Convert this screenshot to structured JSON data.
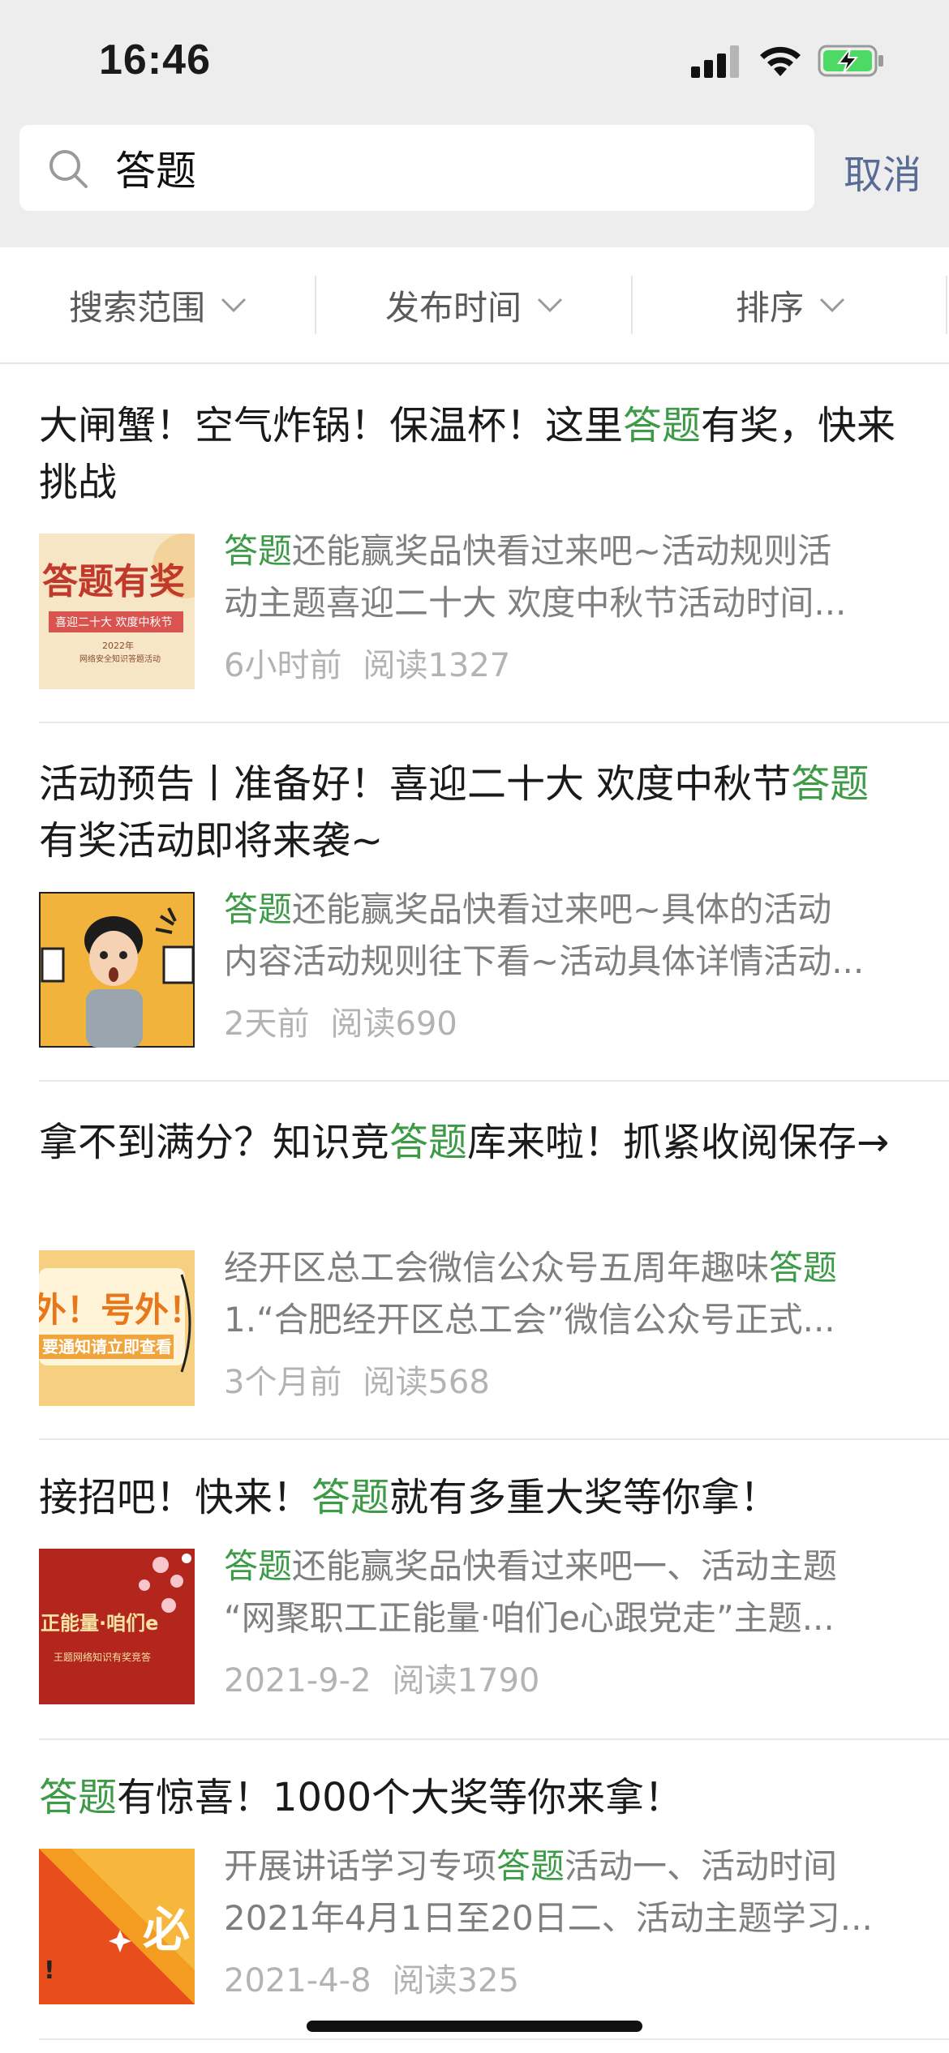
{
  "status_bar": {
    "time": "16:46"
  },
  "search": {
    "query": "答题",
    "cancel_label": "取消"
  },
  "filters": [
    {
      "label": "搜索范围"
    },
    {
      "label": "发布时间"
    },
    {
      "label": "排序"
    }
  ],
  "results": [
    {
      "title_parts": [
        {
          "text": "大闸蟹！空气炸锅！保温杯！这里"
        },
        {
          "text": "答题",
          "hl": true
        },
        {
          "text": "有奖，快来挑战"
        }
      ],
      "desc_lines": [
        [
          {
            "text": "答题",
            "hl": true
          },
          {
            "text": "还能赢奖品快看过来吧~活动规则活"
          }
        ],
        [
          {
            "text": "动主题喜迎二十大 欢度中秋节活动时间..."
          }
        ]
      ],
      "time": "6小时前",
      "reads": "阅读1327",
      "thumb": {
        "big_text": "答题有奖",
        "banner_text": "喜迎二十大 欢度中秋节",
        "small_text": "2022年",
        "small_text2": "网络安全知识答题活动",
        "bg": "#f4e3c4",
        "accent": "#c0392b"
      }
    },
    {
      "title_parts": [
        {
          "text": "活动预告丨准备好！喜迎二十大 欢度中秋节"
        },
        {
          "text": "答题",
          "hl": true
        },
        {
          "text": "有奖活动即将来袭~"
        }
      ],
      "desc_lines": [
        [
          {
            "text": "答题",
            "hl": true
          },
          {
            "text": "还能赢奖品快看过来吧~具体的活动"
          }
        ],
        [
          {
            "text": "内容活动规则往下看~活动具体详情活动..."
          }
        ]
      ],
      "time": "2天前",
      "reads": "阅读690",
      "thumb": {
        "bg": "#f2b33d"
      }
    },
    {
      "title_parts": [
        {
          "text": "拿不到满分？知识竞"
        },
        {
          "text": "答题",
          "hl": true
        },
        {
          "text": "库来啦！抓紧收阅保存→"
        }
      ],
      "desc_lines": [
        [
          {
            "text": "经开区总工会微信公众号五周年趣味"
          },
          {
            "text": "答题",
            "hl": true
          }
        ],
        [
          {
            "text": "1.“合肥经开区总工会”微信公众号正式..."
          }
        ]
      ],
      "time": "3个月前",
      "reads": "阅读568",
      "thumb": {
        "big_text": "外！号外！",
        "banner_text": "要通知请立即查看",
        "bg": "#f6d080"
      }
    },
    {
      "title_parts": [
        {
          "text": "接招吧！快来！"
        },
        {
          "text": "答题",
          "hl": true
        },
        {
          "text": "就有多重大奖等你拿！"
        }
      ],
      "desc_lines": [
        [
          {
            "text": "答题",
            "hl": true
          },
          {
            "text": "还能赢奖品快看过来吧一、活动主题"
          }
        ],
        [
          {
            "text": "“网聚职工正能量·咱们e心跟党走”主题..."
          }
        ]
      ],
      "time": "2021-9-2",
      "reads": "阅读1790",
      "thumb": {
        "big_text": "正能量·咱们e",
        "small_text": "王题网络知识有奖竞答",
        "bg": "#b3261e"
      }
    },
    {
      "title_parts": [
        {
          "text": "答题",
          "hl": true
        },
        {
          "text": "有惊喜！1000个大奖等你来拿！"
        }
      ],
      "desc_lines": [
        [
          {
            "text": "开展讲话学习专项"
          },
          {
            "text": "答题",
            "hl": true
          },
          {
            "text": "活动一、活动时间"
          }
        ],
        [
          {
            "text": "2021年4月1日至20日二、活动主题学习..."
          }
        ]
      ],
      "time": "2021-4-8",
      "reads": "阅读325",
      "thumb": {
        "big_text": "必",
        "bg": "#f39c1f"
      }
    }
  ]
}
